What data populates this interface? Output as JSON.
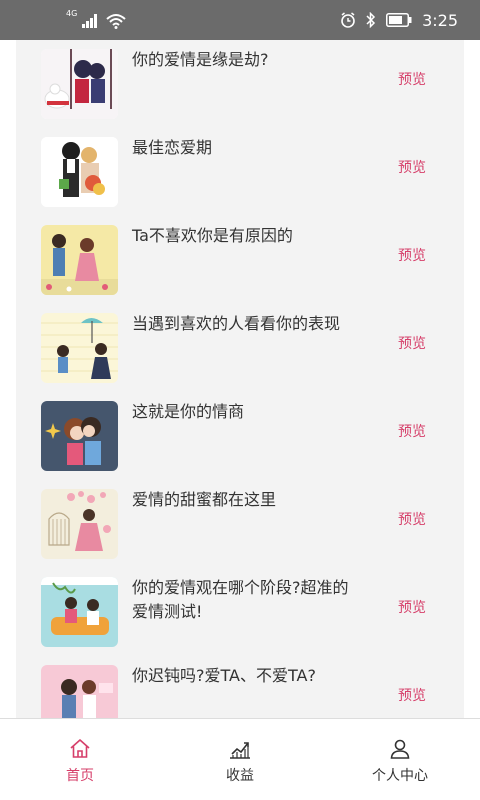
{
  "status_bar": {
    "network": "4G",
    "time": "3:25"
  },
  "articles": [
    {
      "title": "你的爱情是缘是劫?",
      "action": "预览",
      "thumb_icon": "couple-on-swing-icon"
    },
    {
      "title": "最佳恋爱期",
      "action": "预览",
      "thumb_icon": "couple-with-flowers-icon"
    },
    {
      "title": "Ta不喜欢你是有原因的",
      "action": "预览",
      "thumb_icon": "couple-on-meadow-icon"
    },
    {
      "title": "当遇到喜欢的人看看你的表现",
      "action": "预览",
      "thumb_icon": "couple-under-umbrella-icon"
    },
    {
      "title": "这就是你的情商",
      "action": "预览",
      "thumb_icon": "couple-kissing-icon"
    },
    {
      "title": "爱情的甜蜜都在这里",
      "action": "预览",
      "thumb_icon": "girl-with-flowers-icon"
    },
    {
      "title": "你的爱情观在哪个阶段?超准的爱情测试!",
      "action": "预览",
      "thumb_icon": "couple-on-sofa-icon"
    },
    {
      "title": "你迟钝吗?爱TA、不爱TA?",
      "action": "预览",
      "thumb_icon": "couple-pink-icon"
    }
  ],
  "bottom_nav": [
    {
      "label": "首页",
      "icon": "home-icon",
      "active": true
    },
    {
      "label": "收益",
      "icon": "chart-line-icon",
      "active": false
    },
    {
      "label": "个人中心",
      "icon": "person-icon",
      "active": false
    }
  ],
  "colors": {
    "accent": "#d63f6a",
    "status_bar": "#6b6b6b",
    "content_bg": "#f3f3f3"
  }
}
